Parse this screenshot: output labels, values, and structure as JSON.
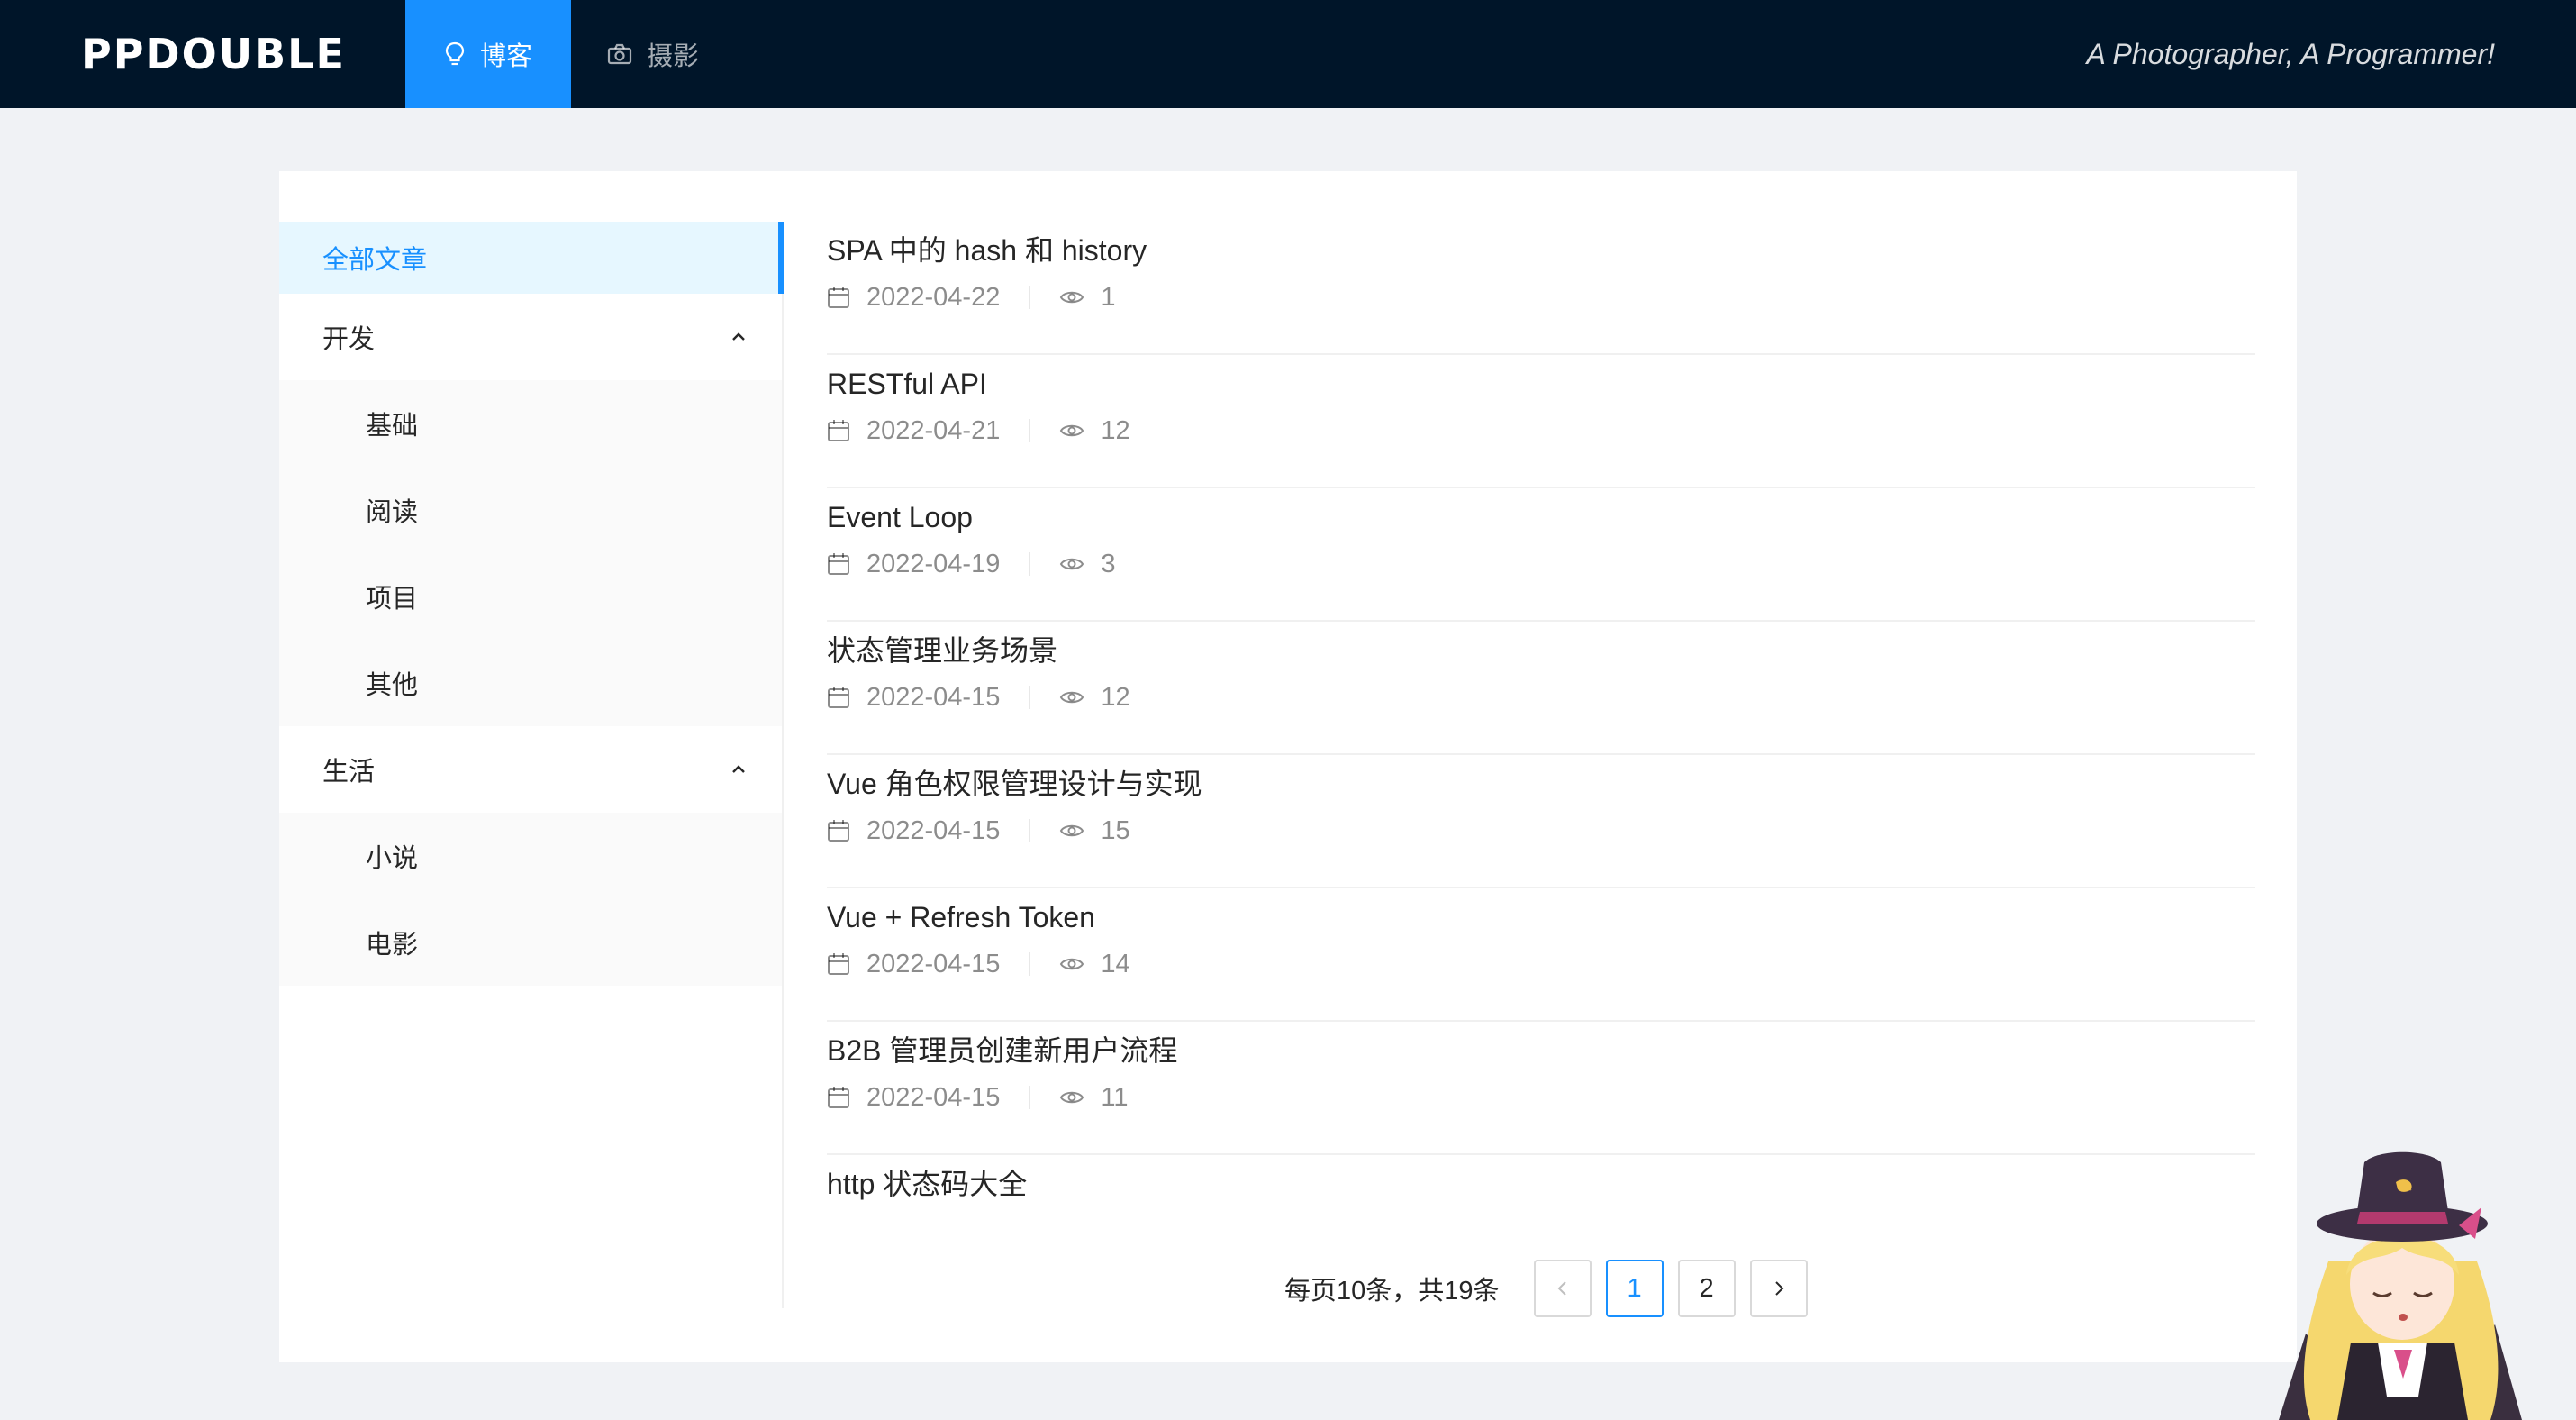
{
  "header": {
    "logo": "PPDOUBLE",
    "nav": [
      {
        "label": "博客",
        "icon": "bulb-icon",
        "active": true
      },
      {
        "label": "摄影",
        "icon": "camera-icon",
        "active": false
      }
    ],
    "tagline": "A Photographer, A Programmer!"
  },
  "sidebar": {
    "all": "全部文章",
    "groups": [
      {
        "label": "开发",
        "items": [
          "基础",
          "阅读",
          "项目",
          "其他"
        ]
      },
      {
        "label": "生活",
        "items": [
          "小说",
          "电影"
        ]
      }
    ]
  },
  "articles": [
    {
      "title": "SPA 中的 hash 和 history",
      "date": "2022-04-22",
      "views": "1"
    },
    {
      "title": "RESTful API",
      "date": "2022-04-21",
      "views": "12"
    },
    {
      "title": "Event Loop",
      "date": "2022-04-19",
      "views": "3"
    },
    {
      "title": "状态管理业务场景",
      "date": "2022-04-15",
      "views": "12"
    },
    {
      "title": "Vue 角色权限管理设计与实现",
      "date": "2022-04-15",
      "views": "15"
    },
    {
      "title": "Vue + Refresh Token",
      "date": "2022-04-15",
      "views": "14"
    },
    {
      "title": "B2B 管理员创建新用户流程",
      "date": "2022-04-15",
      "views": "11"
    },
    {
      "title": "http 状态码大全"
    }
  ],
  "pagination": {
    "total_text": "每页10条，共19条",
    "pages": [
      "1",
      "2"
    ],
    "current": "1",
    "prev_icon": "left-icon",
    "next_icon": "right-icon"
  },
  "colors": {
    "header_bg": "#001529",
    "accent": "#1890ff",
    "page_bg": "#f0f2f5"
  }
}
